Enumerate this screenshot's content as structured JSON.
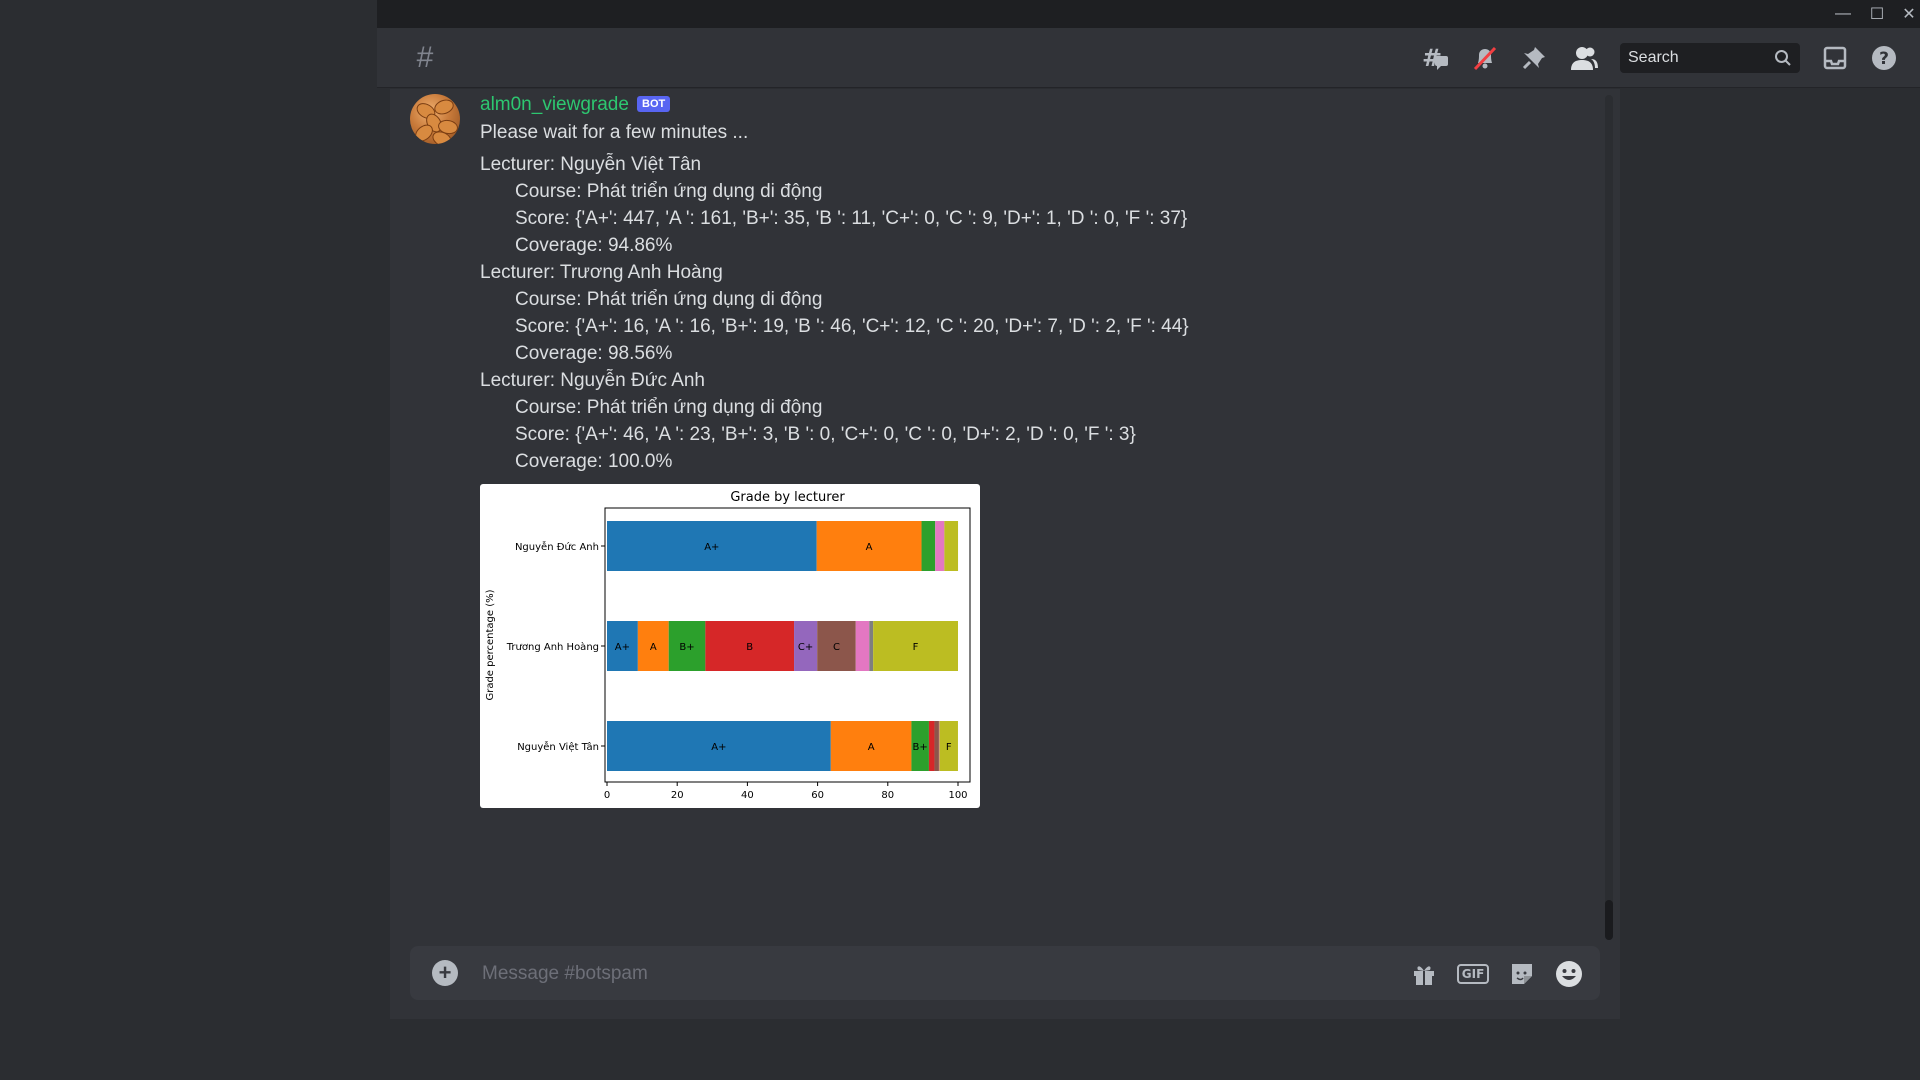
{
  "titlebar": {
    "minimize": "—",
    "maximize": "☐",
    "close": "✕"
  },
  "header": {
    "channel_icon": "#",
    "search_placeholder": "Search",
    "icons": [
      "threads-icon",
      "mute-notifications-icon",
      "pin-icon",
      "members-icon",
      "inbox-icon",
      "help-icon"
    ]
  },
  "message": {
    "username": "alm0n_viewgrade",
    "bot_tag": "BOT",
    "lines": [
      "Please wait for a few minutes ...",
      "Lecturer: Nguyễn Việt Tân",
      "Course: Phát triển ứng dụng di động",
      "Score: {'A+': 447, 'A ': 161, 'B+': 35, 'B ': 11, 'C+': 0, 'C ': 9, 'D+': 1, 'D ': 0, 'F ': 37}",
      "Coverage: 94.86%",
      "Lecturer: Trương Anh Hoàng",
      "Course: Phát triển ứng dụng di động",
      "Score: {'A+': 16, 'A ': 16, 'B+': 19, 'B ': 46, 'C+': 12, 'C ': 20, 'D+': 7, 'D ': 2, 'F ': 44}",
      "Coverage: 98.56%",
      "Lecturer: Nguyễn Đức Anh",
      "Course: Phát triển ứng dụng di động",
      "Score: {'A+': 46, 'A ': 23, 'B+': 3, 'B ': 0, 'C+': 0, 'C ': 0, 'D+': 2, 'D ': 0, 'F ': 3}",
      "Coverage: 100.0%"
    ]
  },
  "chart_data": {
    "type": "bar",
    "orientation": "horizontal",
    "stacked": true,
    "title": "Grade by lecturer",
    "xlabel": "",
    "ylabel": "Grade percentage (%)",
    "xlim": [
      0,
      105
    ],
    "xticks": [
      0,
      20,
      40,
      60,
      80,
      100
    ],
    "categories": [
      "Nguyễn Việt Tân",
      "Trương Anh Hoàng",
      "Nguyễn Đức Anh"
    ],
    "grades": [
      "A+",
      "A",
      "B+",
      "B",
      "C+",
      "C",
      "D+",
      "D",
      "F"
    ],
    "colors": [
      "#1f77b4",
      "#ff7f0e",
      "#2ca02c",
      "#d62728",
      "#9467bd",
      "#8c564b",
      "#e377c2",
      "#7f7f7f",
      "#bcbd22"
    ],
    "series": [
      {
        "name": "A+",
        "values": [
          63.76,
          8.79,
          59.74
        ]
      },
      {
        "name": "A",
        "values": [
          22.97,
          8.79,
          29.87
        ]
      },
      {
        "name": "B+",
        "values": [
          4.99,
          10.44,
          3.9
        ]
      },
      {
        "name": "B",
        "values": [
          1.57,
          25.27,
          0
        ]
      },
      {
        "name": "C+",
        "values": [
          0,
          6.59,
          0
        ]
      },
      {
        "name": "C",
        "values": [
          1.28,
          10.99,
          0
        ]
      },
      {
        "name": "D+",
        "values": [
          0.14,
          3.85,
          2.6
        ]
      },
      {
        "name": "D",
        "values": [
          0,
          1.1,
          0
        ]
      },
      {
        "name": "F",
        "values": [
          5.28,
          24.18,
          3.9
        ]
      }
    ]
  },
  "composer": {
    "placeholder": "Message #botspam",
    "gif_label": "GIF",
    "icons": [
      "add-attachment-icon",
      "gift-icon",
      "gif-icon",
      "sticker-icon",
      "emoji-icon"
    ]
  }
}
